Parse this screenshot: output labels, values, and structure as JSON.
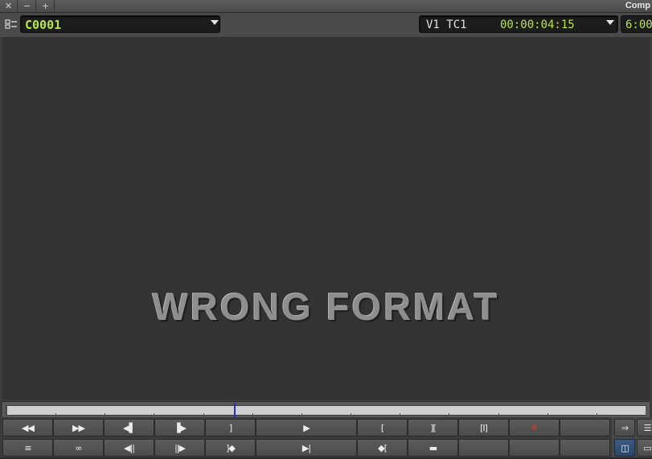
{
  "window": {
    "title": "Comp",
    "close_glyph": "✕",
    "minimize_glyph": "−",
    "maximize_glyph": "+"
  },
  "header": {
    "clip_name": "C0001",
    "track_label": "V1 TC1",
    "timecode": "00:00:04:15",
    "timecode_secondary": "6:00"
  },
  "viewer": {
    "message": "WRONG FORMAT"
  },
  "position_bar": {
    "playhead_fraction": 0.356
  },
  "controls": {
    "row1": [
      {
        "name": "rewind-button",
        "glyph": "◀◀"
      },
      {
        "name": "fast-forward-button",
        "glyph": "▶▶"
      },
      {
        "name": "step-back-one-frame-button",
        "glyph": "◀▌"
      },
      {
        "name": "step-forward-one-frame-button",
        "glyph": "▐▶"
      },
      {
        "name": "mark-out-button",
        "glyph": "]"
      },
      {
        "name": "play-button",
        "glyph": "▶"
      },
      {
        "name": "mark-in-button",
        "glyph": "["
      },
      {
        "name": "mark-clip-button",
        "glyph": "]["
      },
      {
        "name": "clear-both-marks-button",
        "glyph": "[I]"
      },
      {
        "name": "frame-counter",
        "glyph": "0"
      }
    ],
    "row2": [
      {
        "name": "clip-list-button",
        "glyph": "≡"
      },
      {
        "name": "loop-button",
        "glyph": "∞"
      },
      {
        "name": "step-back-ten-frames-button",
        "glyph": "◀||"
      },
      {
        "name": "step-forward-ten-frames-button",
        "glyph": "||▶"
      },
      {
        "name": "go-to-out-button",
        "glyph": "]◆"
      },
      {
        "name": "play-in-to-out-button",
        "glyph": "▶|"
      },
      {
        "name": "go-to-in-button",
        "glyph": "◆["
      },
      {
        "name": "filmstrip-button",
        "glyph": "▬"
      }
    ],
    "side": {
      "match_frame_glyph": "⇒",
      "menu_glyph": "☰",
      "split_view_glyph": "◫",
      "single_view_glyph": "▭"
    }
  },
  "colors": {
    "accent_green": "#b9e34a",
    "counter_red": "#e03a2a",
    "playhead_blue": "#1f2fd8"
  }
}
